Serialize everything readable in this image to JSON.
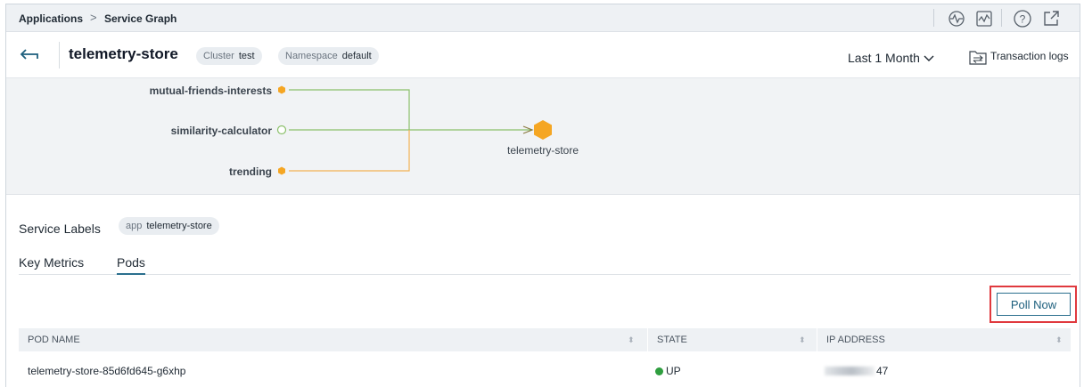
{
  "breadcrumb": {
    "root": "Applications",
    "separator": ">",
    "current": "Service Graph"
  },
  "toolbar_icons": [
    "health-check-icon",
    "performance-icon",
    "help-icon",
    "external-link-icon"
  ],
  "header": {
    "title": "telemetry-store",
    "chips": [
      {
        "key": "Cluster",
        "value": "test"
      },
      {
        "key": "Namespace",
        "value": "default"
      }
    ],
    "time_range": "Last 1 Month",
    "transaction_logs": "Transaction logs"
  },
  "graph": {
    "source_nodes": [
      {
        "name": "mutual-friends-interests",
        "status": "orange",
        "edge_color": "#8bc06a"
      },
      {
        "name": "similarity-calculator",
        "status": "hollow-green",
        "edge_color": "#8bc06a"
      },
      {
        "name": "trending",
        "status": "orange",
        "edge_color": "#f3b253"
      }
    ],
    "target_node": {
      "name": "telemetry-store",
      "color": "#f5a623"
    }
  },
  "service_labels": {
    "title": "Service Labels",
    "labels": [
      {
        "key": "app",
        "value": "telemetry-store"
      }
    ]
  },
  "tabs": [
    {
      "label": "Key Metrics",
      "active": false
    },
    {
      "label": "Pods",
      "active": true
    }
  ],
  "poll_button": "Poll Now",
  "table": {
    "columns": [
      "POD NAME",
      "STATE",
      "IP ADDRESS"
    ],
    "rows": [
      {
        "pod_name": "telemetry-store-85d6fd645-g6xhp",
        "state": "UP",
        "ip_suffix": "47"
      }
    ]
  },
  "colors": {
    "accent": "#2b6f8e",
    "status_up": "#2f9e3f",
    "node_orange": "#f5a623",
    "highlight_red": "#e0393e"
  }
}
